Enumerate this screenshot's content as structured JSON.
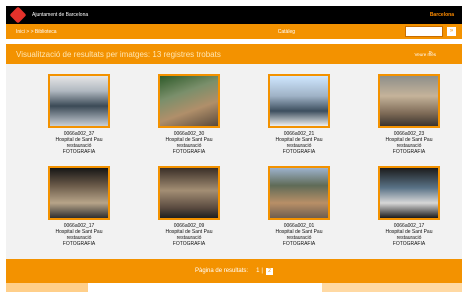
{
  "header": {
    "org": "Ajuntament de Barcelona",
    "right": "Barcelona"
  },
  "nav": {
    "left": "Inici > > Biblioteca",
    "mid": "Catàleg",
    "search_placeholder": "",
    "search_button": "»"
  },
  "results": {
    "title": "Visualització de resultats per imatges: 13 registres trobats",
    "right": "Veure més",
    "arrow": "»",
    "items": [
      {
        "id": "0066a002_37",
        "line1": "Hospital de Sant Pau",
        "line2": "restauració",
        "line3": "FOTOGRAFIA"
      },
      {
        "id": "0066a002_30",
        "line1": "Hospital de Sant Pau",
        "line2": "restauració",
        "line3": "FOTOGRAFIA"
      },
      {
        "id": "0066a002_21",
        "line1": "Hospital de Sant Pau",
        "line2": "restauració",
        "line3": "FOTOGRAFIA"
      },
      {
        "id": "0066a002_23",
        "line1": "Hospital de Sant Pau",
        "line2": "restauració",
        "line3": "FOTOGRAFIA"
      },
      {
        "id": "0066a002_17",
        "line1": "Hospital de Sant Pau",
        "line2": "restauració",
        "line3": "FOTOGRAFIA"
      },
      {
        "id": "0066a002_09",
        "line1": "Hospital de Sant Pau",
        "line2": "restauració",
        "line3": "FOTOGRAFIA"
      },
      {
        "id": "0066a002_01",
        "line1": "Hospital de Sant Pau",
        "line2": "restauració",
        "line3": "FOTOGRAFIA"
      },
      {
        "id": "0066a002_17",
        "line1": "Hospital de Sant Pau",
        "line2": "restauració",
        "line3": "FOTOGRAFIA"
      }
    ]
  },
  "pager": {
    "label": "Pàgina de resultats:",
    "current": "1",
    "sep": "|",
    "next": "2"
  },
  "footer": {
    "left": "",
    "right": ""
  }
}
